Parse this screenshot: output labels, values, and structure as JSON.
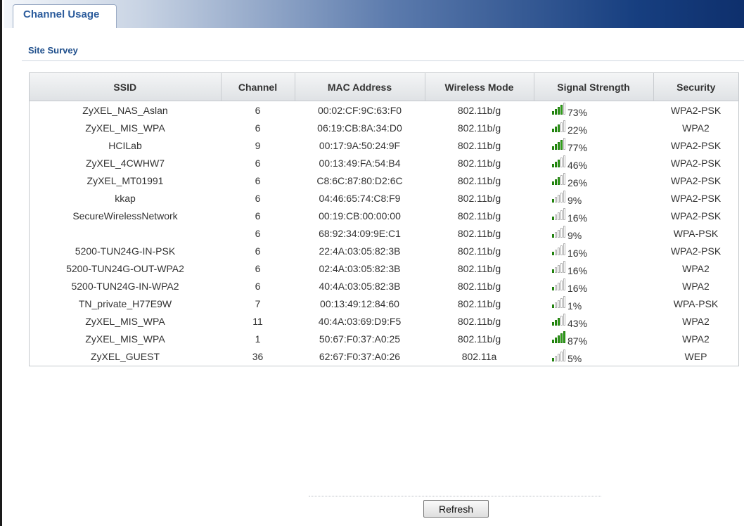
{
  "tabs": [
    {
      "label": "Channel Usage",
      "active": true
    }
  ],
  "section_title": "Site Survey",
  "columns": [
    "SSID",
    "Channel",
    "MAC Address",
    "Wireless Mode",
    "Signal Strength",
    "Security"
  ],
  "rows": [
    {
      "ssid": "ZyXEL_NAS_Aslan",
      "channel": "6",
      "mac": "00:02:CF:9C:63:F0",
      "mode": "802.11b/g",
      "signal_bars": 4,
      "signal": "73%",
      "security": "WPA2-PSK"
    },
    {
      "ssid": "ZyXEL_MIS_WPA",
      "channel": "6",
      "mac": "06:19:CB:8A:34:D0",
      "mode": "802.11b/g",
      "signal_bars": 3,
      "signal": "22%",
      "security": "WPA2"
    },
    {
      "ssid": "HCILab",
      "channel": "9",
      "mac": "00:17:9A:50:24:9F",
      "mode": "802.11b/g",
      "signal_bars": 4,
      "signal": "77%",
      "security": "WPA2-PSK"
    },
    {
      "ssid": "ZyXEL_4CWHW7",
      "channel": "6",
      "mac": "00:13:49:FA:54:B4",
      "mode": "802.11b/g",
      "signal_bars": 3,
      "signal": "46%",
      "security": "WPA2-PSK"
    },
    {
      "ssid": "ZyXEL_MT01991",
      "channel": "6",
      "mac": "C8:6C:87:80:D2:6C",
      "mode": "802.11b/g",
      "signal_bars": 3,
      "signal": "26%",
      "security": "WPA2-PSK"
    },
    {
      "ssid": "kkap",
      "channel": "6",
      "mac": "04:46:65:74:C8:F9",
      "mode": "802.11b/g",
      "signal_bars": 1,
      "signal": "9%",
      "security": "WPA2-PSK"
    },
    {
      "ssid": "SecureWirelessNetwork",
      "channel": "6",
      "mac": "00:19:CB:00:00:00",
      "mode": "802.11b/g",
      "signal_bars": 1,
      "signal": "16%",
      "security": "WPA2-PSK"
    },
    {
      "ssid": "",
      "channel": "6",
      "mac": "68:92:34:09:9E:C1",
      "mode": "802.11b/g",
      "signal_bars": 1,
      "signal": "9%",
      "security": "WPA-PSK"
    },
    {
      "ssid": "5200-TUN24G-IN-PSK",
      "channel": "6",
      "mac": "22:4A:03:05:82:3B",
      "mode": "802.11b/g",
      "signal_bars": 1,
      "signal": "16%",
      "security": "WPA2-PSK"
    },
    {
      "ssid": "5200-TUN24G-OUT-WPA2",
      "channel": "6",
      "mac": "02:4A:03:05:82:3B",
      "mode": "802.11b/g",
      "signal_bars": 1,
      "signal": "16%",
      "security": "WPA2"
    },
    {
      "ssid": "5200-TUN24G-IN-WPA2",
      "channel": "6",
      "mac": "40:4A:03:05:82:3B",
      "mode": "802.11b/g",
      "signal_bars": 1,
      "signal": "16%",
      "security": "WPA2"
    },
    {
      "ssid": "TN_private_H77E9W",
      "channel": "7",
      "mac": "00:13:49:12:84:60",
      "mode": "802.11b/g",
      "signal_bars": 1,
      "signal": "1%",
      "security": "WPA-PSK"
    },
    {
      "ssid": "ZyXEL_MIS_WPA",
      "channel": "11",
      "mac": "40:4A:03:69:D9:F5",
      "mode": "802.11b/g",
      "signal_bars": 3,
      "signal": "43%",
      "security": "WPA2"
    },
    {
      "ssid": "ZyXEL_MIS_WPA",
      "channel": "1",
      "mac": "50:67:F0:37:A0:25",
      "mode": "802.11b/g",
      "signal_bars": 5,
      "signal": "87%",
      "security": "WPA2"
    },
    {
      "ssid": "ZyXEL_GUEST",
      "channel": "36",
      "mac": "62:67:F0:37:A0:26",
      "mode": "802.11a",
      "signal_bars": 1,
      "signal": "5%",
      "security": "WEP"
    }
  ],
  "refresh_label": "Refresh",
  "colors": {
    "signal_on": "#2fa317",
    "signal_off": "#ffffff",
    "section_title": "#1f4f8c",
    "tab_label": "#2c5c9c"
  }
}
